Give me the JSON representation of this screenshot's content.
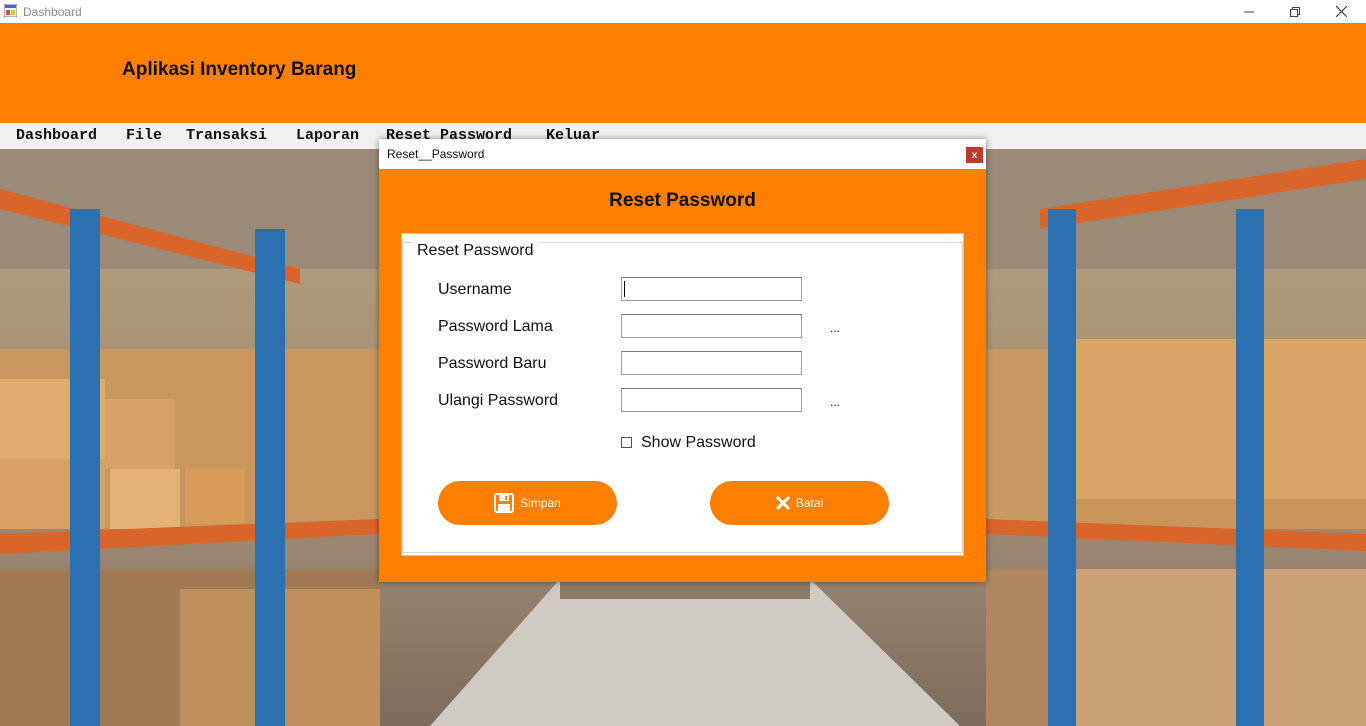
{
  "window": {
    "title": "Dashboard",
    "controls": [
      "minimize-icon",
      "restore-icon",
      "close-icon"
    ]
  },
  "header": {
    "app_title": "Aplikasi Inventory Barang",
    "color": "#ff7f00"
  },
  "menu": {
    "items": [
      "Dashboard",
      "File",
      "Transaksi",
      "Laporan",
      "Reset Password",
      "Keluar"
    ]
  },
  "dialog": {
    "title": "Reset__Password",
    "close_label": "x",
    "heading": "Reset Password",
    "group_title": "Reset Password",
    "fields": [
      {
        "label": "Username",
        "value": "",
        "reveal": ""
      },
      {
        "label": "Password Lama",
        "value": "",
        "reveal": "..."
      },
      {
        "label": "Password Baru",
        "value": "",
        "reveal": ""
      },
      {
        "label": "Ulangi Password",
        "value": "",
        "reveal": "..."
      }
    ],
    "show_password": {
      "label": "Show Password",
      "checked": false
    },
    "buttons": {
      "save": {
        "label": "Simpan",
        "icon": "floppy-disk-icon"
      },
      "cancel": {
        "label": "Batal",
        "icon": "x-icon"
      }
    },
    "accent": "#ff7f00"
  }
}
